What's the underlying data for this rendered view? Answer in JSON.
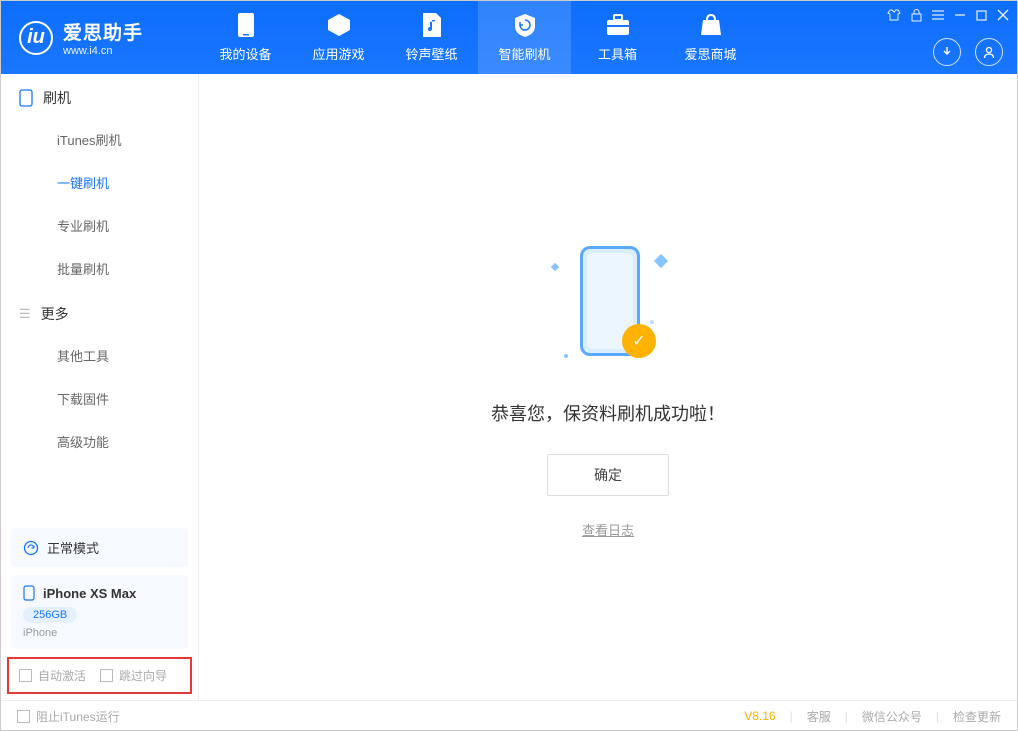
{
  "app": {
    "name": "爱思助手",
    "url": "www.i4.cn"
  },
  "nav": {
    "tabs": [
      {
        "label": "我的设备"
      },
      {
        "label": "应用游戏"
      },
      {
        "label": "铃声壁纸"
      },
      {
        "label": "智能刷机"
      },
      {
        "label": "工具箱"
      },
      {
        "label": "爱思商城"
      }
    ]
  },
  "sidebar": {
    "section1": {
      "title": "刷机"
    },
    "items1": [
      {
        "label": "iTunes刷机"
      },
      {
        "label": "一键刷机"
      },
      {
        "label": "专业刷机"
      },
      {
        "label": "批量刷机"
      }
    ],
    "section2": {
      "title": "更多"
    },
    "items2": [
      {
        "label": "其他工具"
      },
      {
        "label": "下载固件"
      },
      {
        "label": "高级功能"
      }
    ]
  },
  "device": {
    "mode": "正常模式",
    "name": "iPhone XS Max",
    "storage": "256GB",
    "type": "iPhone"
  },
  "options": {
    "auto_activate": "自动激活",
    "skip_wizard": "跳过向导"
  },
  "main": {
    "success_text": "恭喜您，保资料刷机成功啦！",
    "ok_button": "确定",
    "view_log": "查看日志"
  },
  "statusbar": {
    "block_itunes": "阻止iTunes运行",
    "version": "V8.16",
    "customer_service": "客服",
    "wechat": "微信公众号",
    "check_update": "检查更新"
  }
}
